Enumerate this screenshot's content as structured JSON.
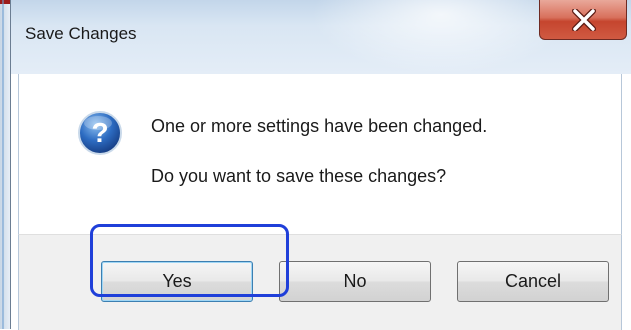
{
  "dialog": {
    "title": "Save Changes",
    "close_icon": "close-x-icon",
    "icon": "question-icon",
    "message_line1": "One or more settings have been changed.",
    "message_line2": "Do you want to save these changes?",
    "buttons": {
      "yes_label": "Yes",
      "no_label": "No",
      "cancel_label": "Cancel"
    },
    "highlighted_button": "Yes"
  },
  "colors": {
    "highlight_outline": "#1f3fd9",
    "close_button": "#c5452e",
    "question_icon": "#2d6cc2",
    "titlebar": "#d9e6f3"
  }
}
